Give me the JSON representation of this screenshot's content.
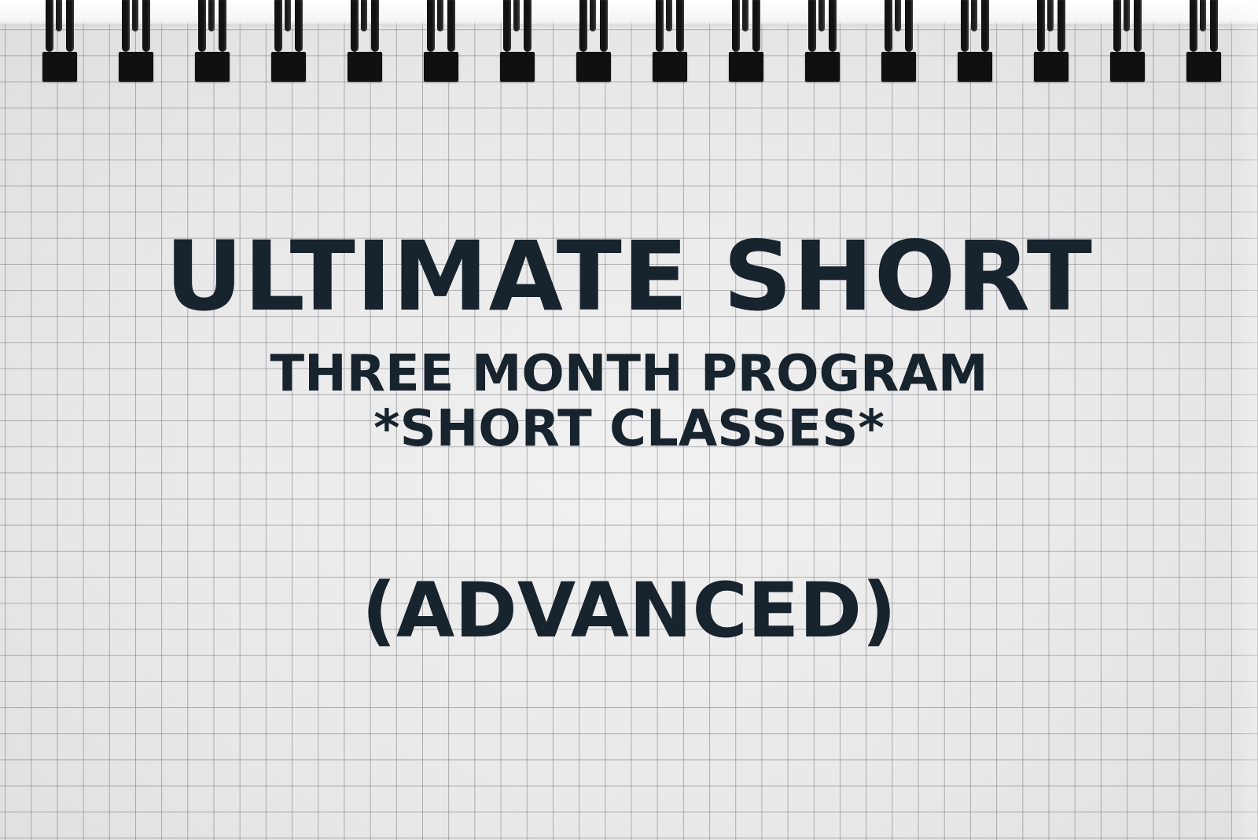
{
  "title": "ULTIMATE SHORT",
  "subtitle": "THREE MONTH PROGRAM",
  "note": "*SHORT CLASSES*",
  "level": "(ADVANCED)",
  "colors": {
    "text": "#17232d",
    "paper": "#ebebeb",
    "grid": "#78787f",
    "rings": "#121212"
  },
  "background": {
    "paper_style": "grid-notebook",
    "binding": "spiral-rings"
  }
}
